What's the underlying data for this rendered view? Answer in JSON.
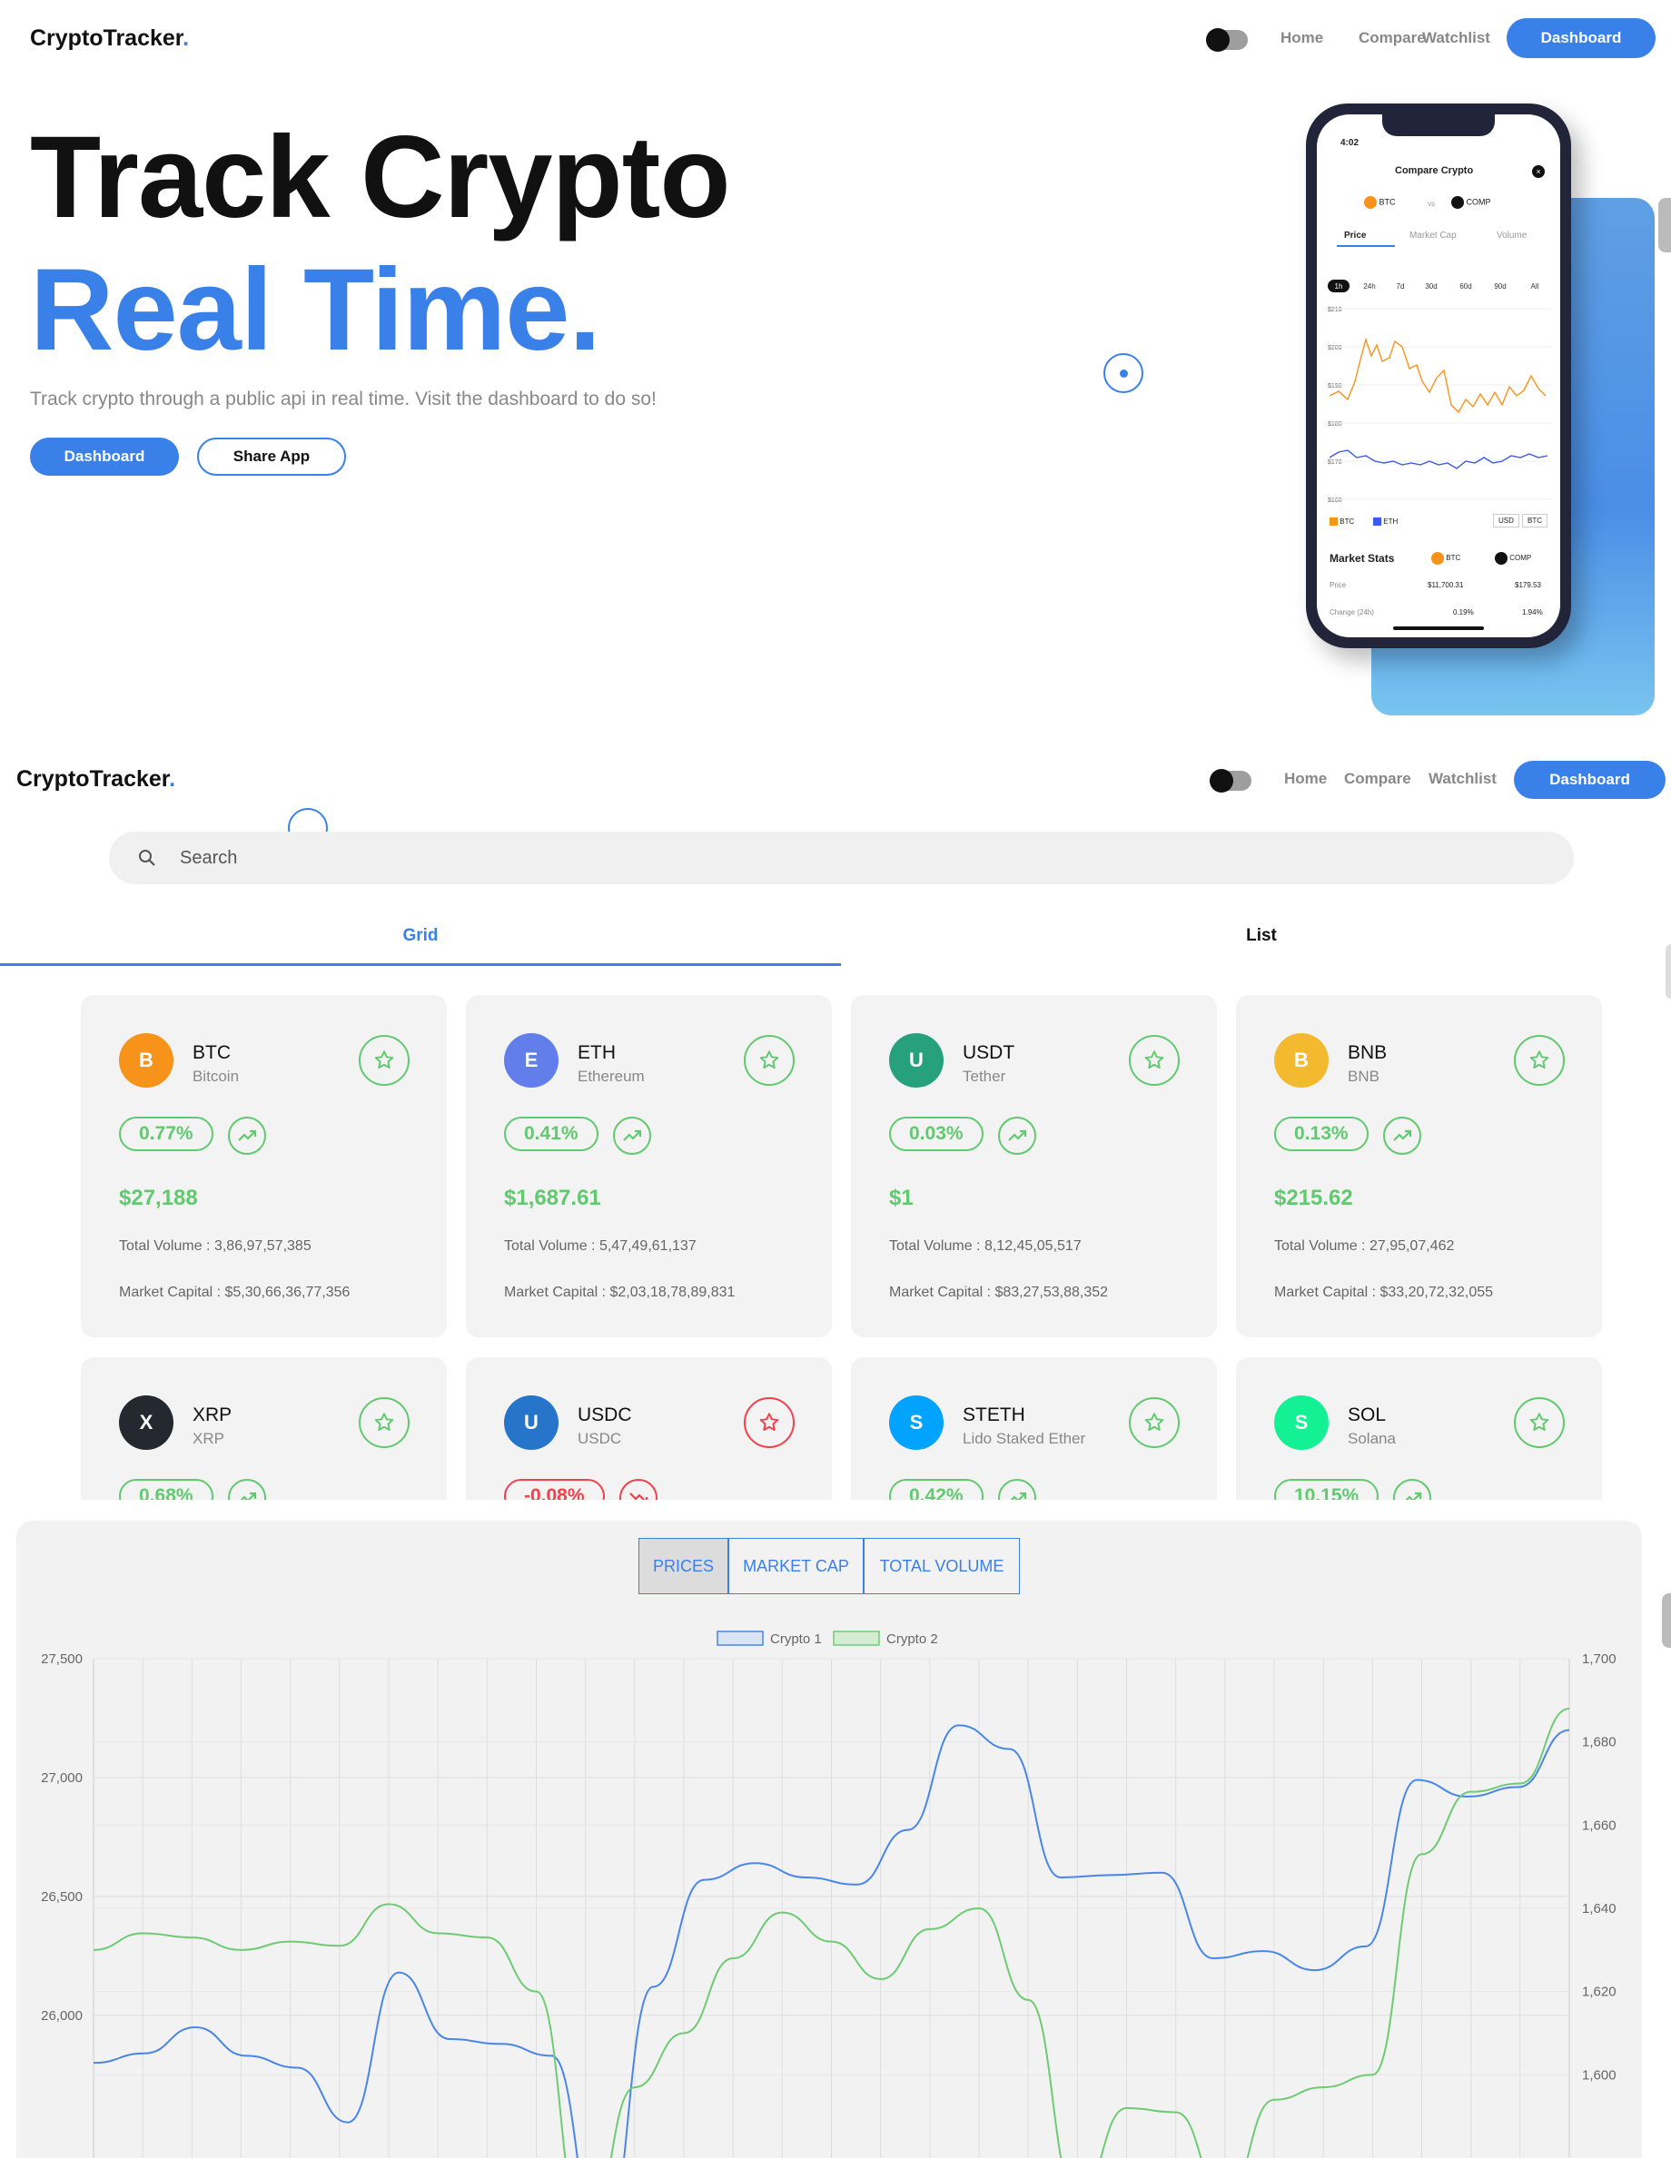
{
  "brand": {
    "name": "CryptoTracker",
    "dot": "."
  },
  "nav": {
    "home": "Home",
    "compare": "Compare",
    "watchlist": "Watchlist",
    "dashboard": "Dashboard"
  },
  "hero": {
    "line1": "Track Crypto",
    "line2": "Real Time.",
    "subtitle": "Track crypto through a public api in real time. Visit the dashboard to do so!",
    "primary_button": "Dashboard",
    "secondary_button": "Share App"
  },
  "phone": {
    "time": "4:02",
    "title": "Compare Crypto",
    "coin_a": "BTC",
    "vs": "vs",
    "coin_b": "COMP",
    "tabs": [
      "Price",
      "Market Cap",
      "Volume"
    ],
    "ranges": [
      "1h",
      "24h",
      "7d",
      "30d",
      "60d",
      "90d",
      "All"
    ],
    "y_labels": [
      "$210",
      "$200",
      "$190",
      "$180",
      "$170",
      "$160"
    ],
    "legend": [
      "BTC",
      "ETH"
    ],
    "currency": [
      "USD",
      "BTC"
    ],
    "stats_title": "Market Stats",
    "stats_rows": [
      {
        "label": "Price",
        "a": "$11,700.31",
        "b": "$179.53"
      },
      {
        "label": "Change (24h)",
        "a": "0.19%",
        "b": "1.94%"
      }
    ]
  },
  "search": {
    "placeholder": "Search"
  },
  "tabs": {
    "grid": "Grid",
    "list": "List"
  },
  "coins": [
    {
      "symbol": "BTC",
      "name": "Bitcoin",
      "change": "0.77%",
      "price": "$27,188",
      "volume": "Total Volume : 3,86,97,57,385",
      "cap": "Market Capital : $5,30,66,36,77,356",
      "trend": "up",
      "color": "#f7931a"
    },
    {
      "symbol": "ETH",
      "name": "Ethereum",
      "change": "0.41%",
      "price": "$1,687.61",
      "volume": "Total Volume : 5,47,49,61,137",
      "cap": "Market Capital : $2,03,18,78,89,831",
      "trend": "up",
      "color": "#627eea"
    },
    {
      "symbol": "USDT",
      "name": "Tether",
      "change": "0.03%",
      "price": "$1",
      "volume": "Total Volume : 8,12,45,05,517",
      "cap": "Market Capital : $83,27,53,88,352",
      "trend": "up",
      "color": "#26a17b"
    },
    {
      "symbol": "BNB",
      "name": "BNB",
      "change": "0.13%",
      "price": "$215.62",
      "volume": "Total Volume : 27,95,07,462",
      "cap": "Market Capital : $33,20,72,32,055",
      "trend": "up",
      "color": "#f3ba2f"
    },
    {
      "symbol": "XRP",
      "name": "XRP",
      "change": "0.68%",
      "price": "",
      "volume": "",
      "cap": "",
      "trend": "up",
      "color": "#23292f"
    },
    {
      "symbol": "USDC",
      "name": "USDC",
      "change": "-0.08%",
      "price": "",
      "volume": "",
      "cap": "",
      "trend": "down",
      "color": "#2775ca"
    },
    {
      "symbol": "STETH",
      "name": "Lido Staked Ether",
      "change": "0.42%",
      "price": "",
      "volume": "",
      "cap": "",
      "trend": "up",
      "color": "#00a3ff"
    },
    {
      "symbol": "SOL",
      "name": "Solana",
      "change": "10.15%",
      "price": "",
      "volume": "",
      "cap": "",
      "trend": "up",
      "color": "#14f195"
    }
  ],
  "chart_toggle": {
    "prices": "PRICES",
    "market_cap": "MARKET CAP",
    "total_volume": "TOTAL VOLUME"
  },
  "chart_data": {
    "type": "line",
    "series": [
      {
        "name": "Crypto 1",
        "axis": "left",
        "color": "#4a86e8",
        "values": [
          25800,
          25840,
          25950,
          25830,
          25780,
          25550,
          26180,
          25900,
          25880,
          25830,
          25000,
          26120,
          26570,
          26640,
          26580,
          26550,
          26780,
          27220,
          27120,
          26580,
          26590,
          26600,
          26240,
          26270,
          26190,
          26290,
          26990,
          26920,
          26960,
          27200
        ]
      },
      {
        "name": "Crypto 2",
        "axis": "right",
        "color": "#6ecb74",
        "values": [
          1630,
          1634,
          1633,
          1630,
          1632,
          1631,
          1641,
          1634,
          1633,
          1620,
          1560,
          1597,
          1610,
          1628,
          1639,
          1632,
          1623,
          1635,
          1640,
          1618,
          1570,
          1592,
          1591,
          1570,
          1594,
          1597,
          1600,
          1653,
          1668,
          1670,
          1688
        ]
      }
    ],
    "legend": [
      "Crypto 1",
      "Crypto 2"
    ],
    "y_left_ticks": [
      "27,500",
      "27,000",
      "26,500",
      "26,000"
    ],
    "y_right_ticks": [
      "1,700",
      "1,680",
      "1,660",
      "1,640",
      "1,620",
      "1,600"
    ],
    "y_left_range": [
      25400,
      27500
    ],
    "y_right_range": [
      1580,
      1700
    ],
    "grid": true,
    "legend_position": "top"
  }
}
